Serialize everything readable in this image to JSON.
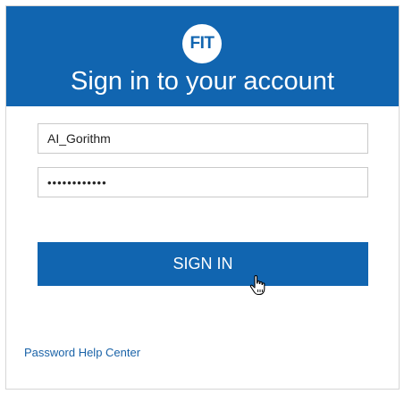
{
  "header": {
    "logo_text": "FIT",
    "title": "Sign in to your account"
  },
  "form": {
    "username_value": "AI_Gorithm",
    "password_value": "••••••••••••",
    "signin_label": "SIGN IN"
  },
  "footer": {
    "help_link": "Password Help Center"
  },
  "colors": {
    "brand": "#1165b0",
    "link": "#1a63a8"
  },
  "icons": {
    "cursor": "hand-pointer-icon"
  }
}
